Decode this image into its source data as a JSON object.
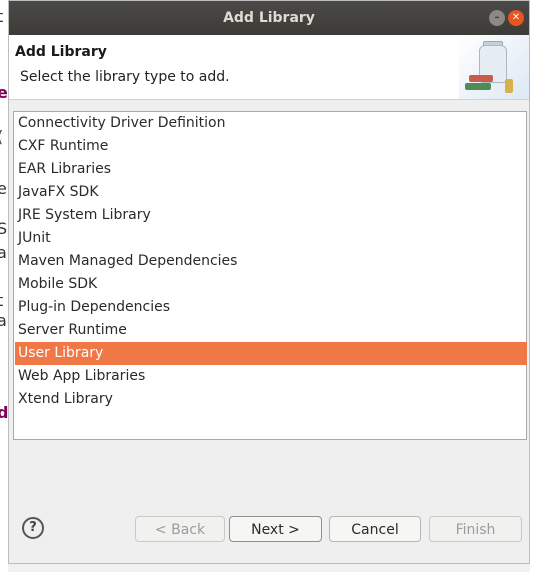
{
  "dialog": {
    "window_title": "Add Library",
    "header_title": "Add Library",
    "header_subtitle": "Select the library type to add."
  },
  "library_types": [
    {
      "label": "Connectivity Driver Definition",
      "selected": false
    },
    {
      "label": "CXF Runtime",
      "selected": false
    },
    {
      "label": "EAR Libraries",
      "selected": false
    },
    {
      "label": "JavaFX SDK",
      "selected": false
    },
    {
      "label": "JRE System Library",
      "selected": false
    },
    {
      "label": "JUnit",
      "selected": false
    },
    {
      "label": "Maven Managed Dependencies",
      "selected": false
    },
    {
      "label": "Mobile SDK",
      "selected": false
    },
    {
      "label": "Plug-in Dependencies",
      "selected": false
    },
    {
      "label": "Server Runtime",
      "selected": false
    },
    {
      "label": "User Library",
      "selected": true
    },
    {
      "label": "Web App Libraries",
      "selected": false
    },
    {
      "label": "Xtend Library",
      "selected": false
    }
  ],
  "buttons": {
    "back": "< Back",
    "next": "Next >",
    "cancel": "Cancel",
    "finish": "Finish",
    "help_glyph": "?"
  },
  "colors": {
    "selection": "#f07746",
    "titlebar": "#3c3b37",
    "close": "#e9541f"
  }
}
